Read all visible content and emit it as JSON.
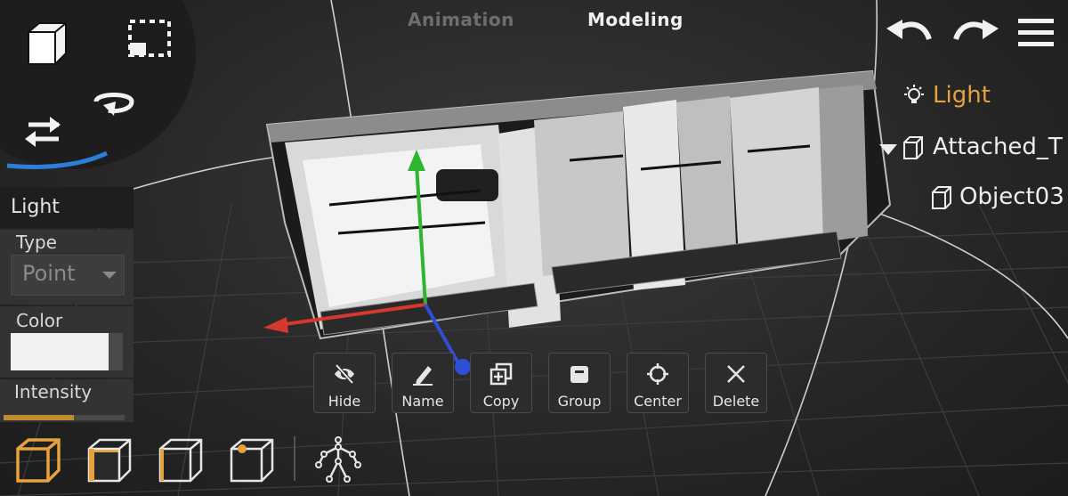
{
  "header": {
    "tabs": [
      {
        "label": "Animation",
        "active": false
      },
      {
        "label": "Modeling",
        "active": true
      }
    ]
  },
  "toolbar": {
    "icons": [
      "cube-view-icon",
      "marquee-select-icon",
      "swap-arrows-icon",
      "rotate-icon",
      "undo-icon",
      "redo-icon",
      "menu-icon"
    ]
  },
  "light_panel": {
    "title": "Light",
    "type_label": "Type",
    "type_value": "Point",
    "color_label": "Color",
    "color_value": "#f2f2f2",
    "intensity_label": "Intensity",
    "intensity_fraction": 0.58
  },
  "action_bar": {
    "buttons": [
      {
        "label": "Hide",
        "icon": "eye-slash-icon"
      },
      {
        "label": "Name",
        "icon": "pencil-icon"
      },
      {
        "label": "Copy",
        "icon": "copy-icon"
      },
      {
        "label": "Group",
        "icon": "group-box-icon"
      },
      {
        "label": "Center",
        "icon": "crosshair-icon"
      },
      {
        "label": "Delete",
        "icon": "close-icon"
      }
    ]
  },
  "scene_tree": {
    "items": [
      {
        "label": "Light",
        "icon": "lightbulb-icon",
        "selected": true
      },
      {
        "label": "Attached_T",
        "icon": "cube-icon",
        "expanded": true
      },
      {
        "label": "Object03",
        "icon": "cube-icon"
      }
    ]
  },
  "selection_modes": [
    "object-mode-icon",
    "face-mode-icon",
    "edge-mode-icon",
    "vertex-mode-icon",
    "skeleton-icon"
  ],
  "colors": {
    "accent": "#e6a23c",
    "axis_x": "#d6382d",
    "axis_y": "#2fb52f",
    "axis_z": "#2f4fd6"
  }
}
